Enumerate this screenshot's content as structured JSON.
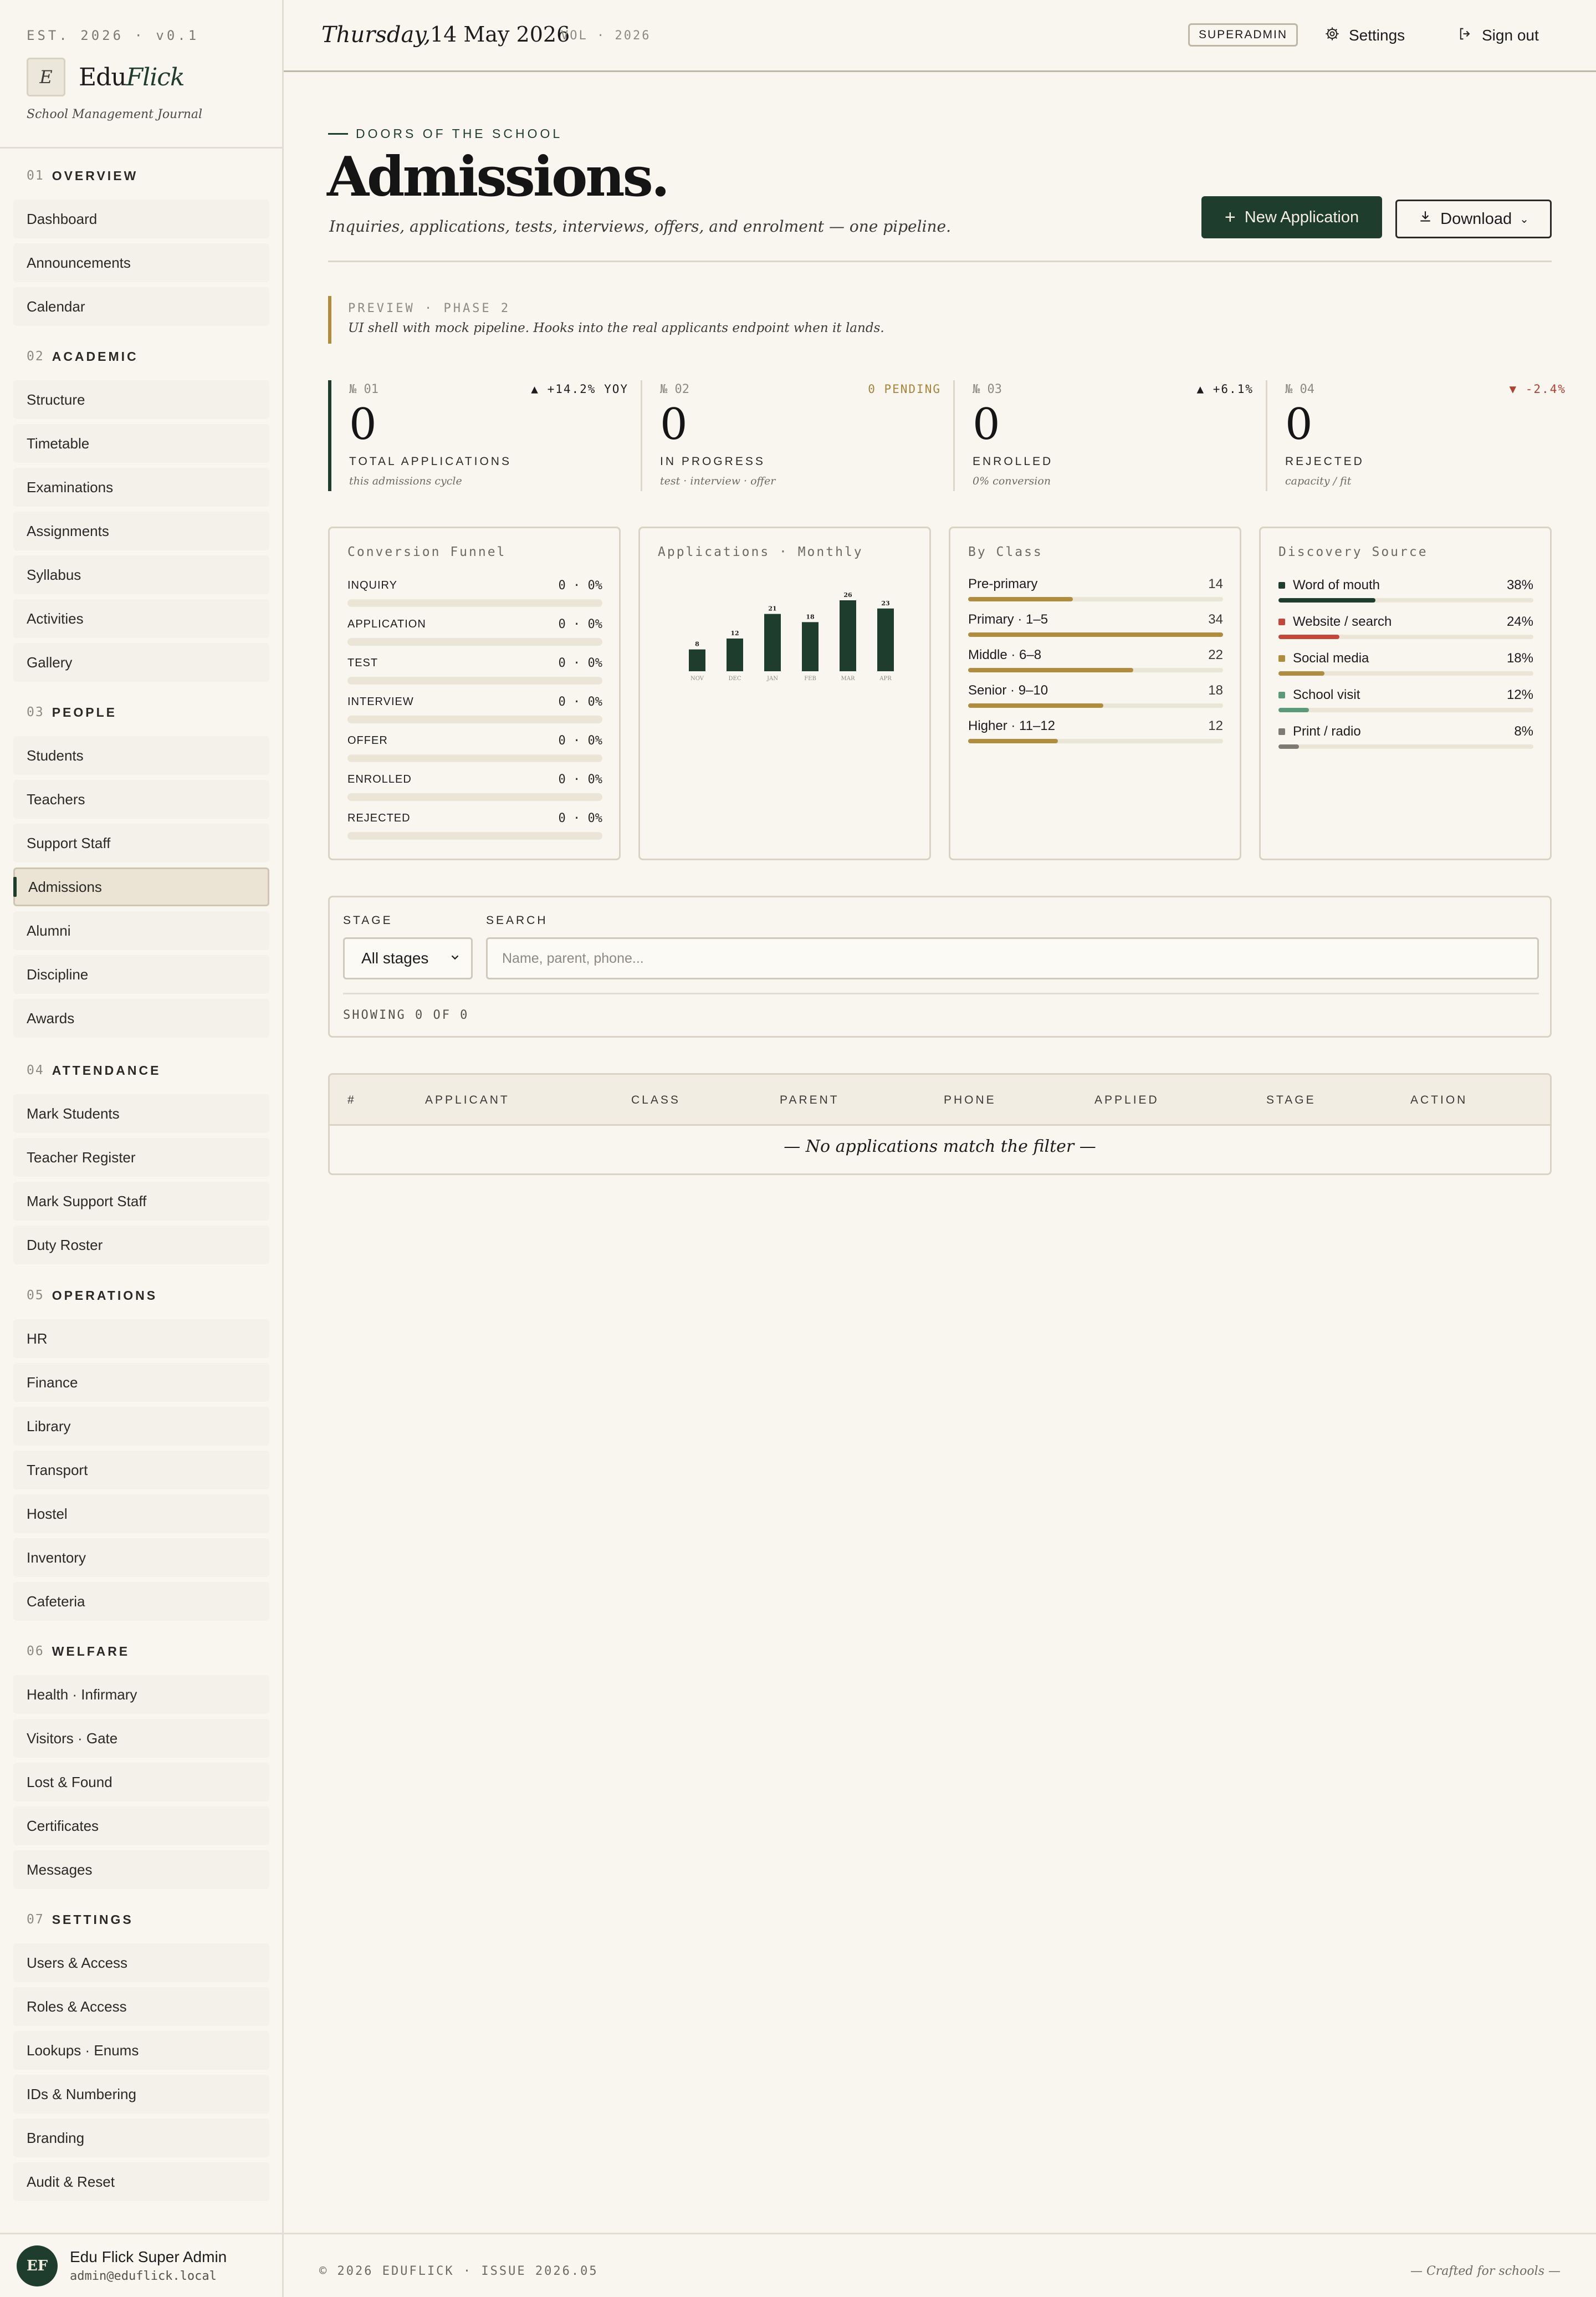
{
  "brand": {
    "est": "EST. 2026 · v0.1",
    "mark": "E",
    "name_a": "Edu",
    "name_b": "Flick",
    "tagline": "School Management Journal"
  },
  "sidebar": {
    "sections": [
      {
        "num": "01",
        "label": "OVERVIEW",
        "items": [
          "Dashboard",
          "Announcements",
          "Calendar"
        ]
      },
      {
        "num": "02",
        "label": "ACADEMIC",
        "items": [
          "Structure",
          "Timetable",
          "Examinations",
          "Assignments",
          "Syllabus",
          "Activities",
          "Gallery"
        ]
      },
      {
        "num": "03",
        "label": "PEOPLE",
        "items": [
          "Students",
          "Teachers",
          "Support Staff",
          "Admissions",
          "Alumni",
          "Discipline",
          "Awards"
        ]
      },
      {
        "num": "04",
        "label": "ATTENDANCE",
        "items": [
          "Mark Students",
          "Teacher Register",
          "Mark Support Staff",
          "Duty Roster"
        ]
      },
      {
        "num": "05",
        "label": "OPERATIONS",
        "items": [
          "HR",
          "Finance",
          "Library",
          "Transport",
          "Hostel",
          "Inventory",
          "Cafeteria"
        ]
      },
      {
        "num": "06",
        "label": "WELFARE",
        "items": [
          "Health · Infirmary",
          "Visitors · Gate",
          "Lost & Found",
          "Certificates",
          "Messages"
        ]
      },
      {
        "num": "07",
        "label": "SETTINGS",
        "items": [
          "Users & Access",
          "Roles & Access",
          "Lookups · Enums",
          "IDs & Numbering",
          "Branding",
          "Audit & Reset"
        ]
      }
    ],
    "active": "Admissions"
  },
  "user": {
    "initials": "EF",
    "name": "Edu Flick Super Admin",
    "email": "admin@eduflick.local"
  },
  "topbar": {
    "day": "Thursday,",
    "date": "14 May 2026",
    "vol": "VOL · 2026",
    "role": "SUPERADMIN",
    "settings": "Settings",
    "signout": "Sign out"
  },
  "header": {
    "kicker": "DOORS OF THE SCHOOL",
    "title": "Admissions.",
    "subtitle": "Inquiries, applications, tests, interviews, offers, and enrolment — one pipeline.",
    "new_btn": "New Application",
    "download_btn": "Download"
  },
  "preview": {
    "tag": "PREVIEW · PHASE 2",
    "text": "UI shell with mock pipeline. Hooks into the real applicants endpoint when it lands."
  },
  "kpis": [
    {
      "num": "№ 01",
      "delta": "▲ +14.2% YOY",
      "delta_color": "#1c1c1c",
      "value": "0",
      "label": "TOTAL APPLICATIONS",
      "note": "this admissions cycle"
    },
    {
      "num": "№ 02",
      "delta": "0 PENDING",
      "delta_color": "#a8843a",
      "value": "0",
      "label": "IN PROGRESS",
      "note": "test · interview · offer"
    },
    {
      "num": "№ 03",
      "delta": "▲ +6.1%",
      "delta_color": "#1c1c1c",
      "value": "0",
      "label": "ENROLLED",
      "note": "0% conversion"
    },
    {
      "num": "№ 04",
      "delta": "▼ -2.4%",
      "delta_color": "#b0412f",
      "value": "0",
      "label": "REJECTED",
      "note": "capacity / fit"
    }
  ],
  "funnel": {
    "title": "Conversion Funnel",
    "rows": [
      {
        "name": "INQUIRY",
        "value": "0 · 0%"
      },
      {
        "name": "APPLICATION",
        "value": "0 · 0%"
      },
      {
        "name": "TEST",
        "value": "0 · 0%"
      },
      {
        "name": "INTERVIEW",
        "value": "0 · 0%"
      },
      {
        "name": "OFFER",
        "value": "0 · 0%"
      },
      {
        "name": "ENROLLED",
        "value": "0 · 0%"
      },
      {
        "name": "REJECTED",
        "value": "0 · 0%"
      }
    ]
  },
  "chart_data": {
    "type": "bar",
    "title": "Applications · Monthly",
    "categories": [
      "NOV",
      "DEC",
      "JAN",
      "FEB",
      "MAR",
      "APR"
    ],
    "values": [
      8,
      12,
      21,
      18,
      26,
      23
    ],
    "ylim": [
      0,
      26
    ],
    "color": "#1f3d2d"
  },
  "by_class": {
    "title": "By Class",
    "max": 34,
    "rows": [
      {
        "name": "Pre-primary",
        "value": 14
      },
      {
        "name": "Primary · 1–5",
        "value": 34
      },
      {
        "name": "Middle · 6–8",
        "value": 22
      },
      {
        "name": "Senior · 9–10",
        "value": 18
      },
      {
        "name": "Higher · 11–12",
        "value": 12
      }
    ]
  },
  "discovery": {
    "title": "Discovery Source",
    "rows": [
      {
        "name": "Word of mouth",
        "value": "38%",
        "pct": 38,
        "color": "#1f3d2d"
      },
      {
        "name": "Website / search",
        "value": "24%",
        "pct": 24,
        "color": "#c2483a"
      },
      {
        "name": "Social media",
        "value": "18%",
        "pct": 18,
        "color": "#b08d3e"
      },
      {
        "name": "School visit",
        "value": "12%",
        "pct": 12,
        "color": "#5a9a78"
      },
      {
        "name": "Print / radio",
        "value": "8%",
        "pct": 8,
        "color": "#7d7a72"
      }
    ]
  },
  "filter": {
    "stage_label": "STAGE",
    "stage_value": "All stages",
    "search_label": "SEARCH",
    "search_placeholder": "Name, parent, phone...",
    "showing": "SHOWING 0 OF 0"
  },
  "table": {
    "columns": [
      "#",
      "APPLICANT",
      "CLASS",
      "PARENT",
      "PHONE",
      "APPLIED",
      "STAGE",
      "ACTION"
    ],
    "empty": "— No applications match the filter —"
  },
  "footer": {
    "left": "© 2026 EDUFLICK · ISSUE 2026.05",
    "right": "— Crafted for schools —"
  }
}
